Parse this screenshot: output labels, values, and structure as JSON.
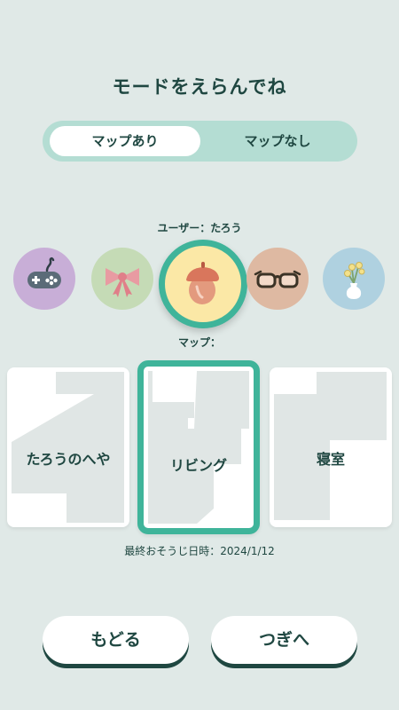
{
  "header": {
    "title": "モードをえらんでね"
  },
  "mode_toggle": {
    "option_left": "マップあり",
    "option_right": "マップなし",
    "selected": "マップあり"
  },
  "users": {
    "label": "ユーザー：たろう",
    "avatars": [
      {
        "icon": "gamepad-icon",
        "color": "#c8aed7"
      },
      {
        "icon": "ribbon-icon",
        "color": "#c5dbb6"
      },
      {
        "icon": "acorn-icon",
        "color": "#fbe8a6",
        "selected": true
      },
      {
        "icon": "glasses-icon",
        "color": "#deb9a2"
      },
      {
        "icon": "flower-vase-icon",
        "color": "#afd1e0"
      }
    ]
  },
  "maps": {
    "label": "マップ：",
    "cards": [
      {
        "name": "たろうのへや"
      },
      {
        "name": "リビング",
        "selected": true
      },
      {
        "name": "寝室"
      }
    ]
  },
  "last_cleaned": "最終おそうじ日時：2024/1/12",
  "buttons": {
    "back": "もどる",
    "next": "つぎへ"
  },
  "colors": {
    "accent": "#3fb49a",
    "text": "#1f4741",
    "background": "#e0e9e7",
    "toggle_bg": "#b4ddd3"
  }
}
